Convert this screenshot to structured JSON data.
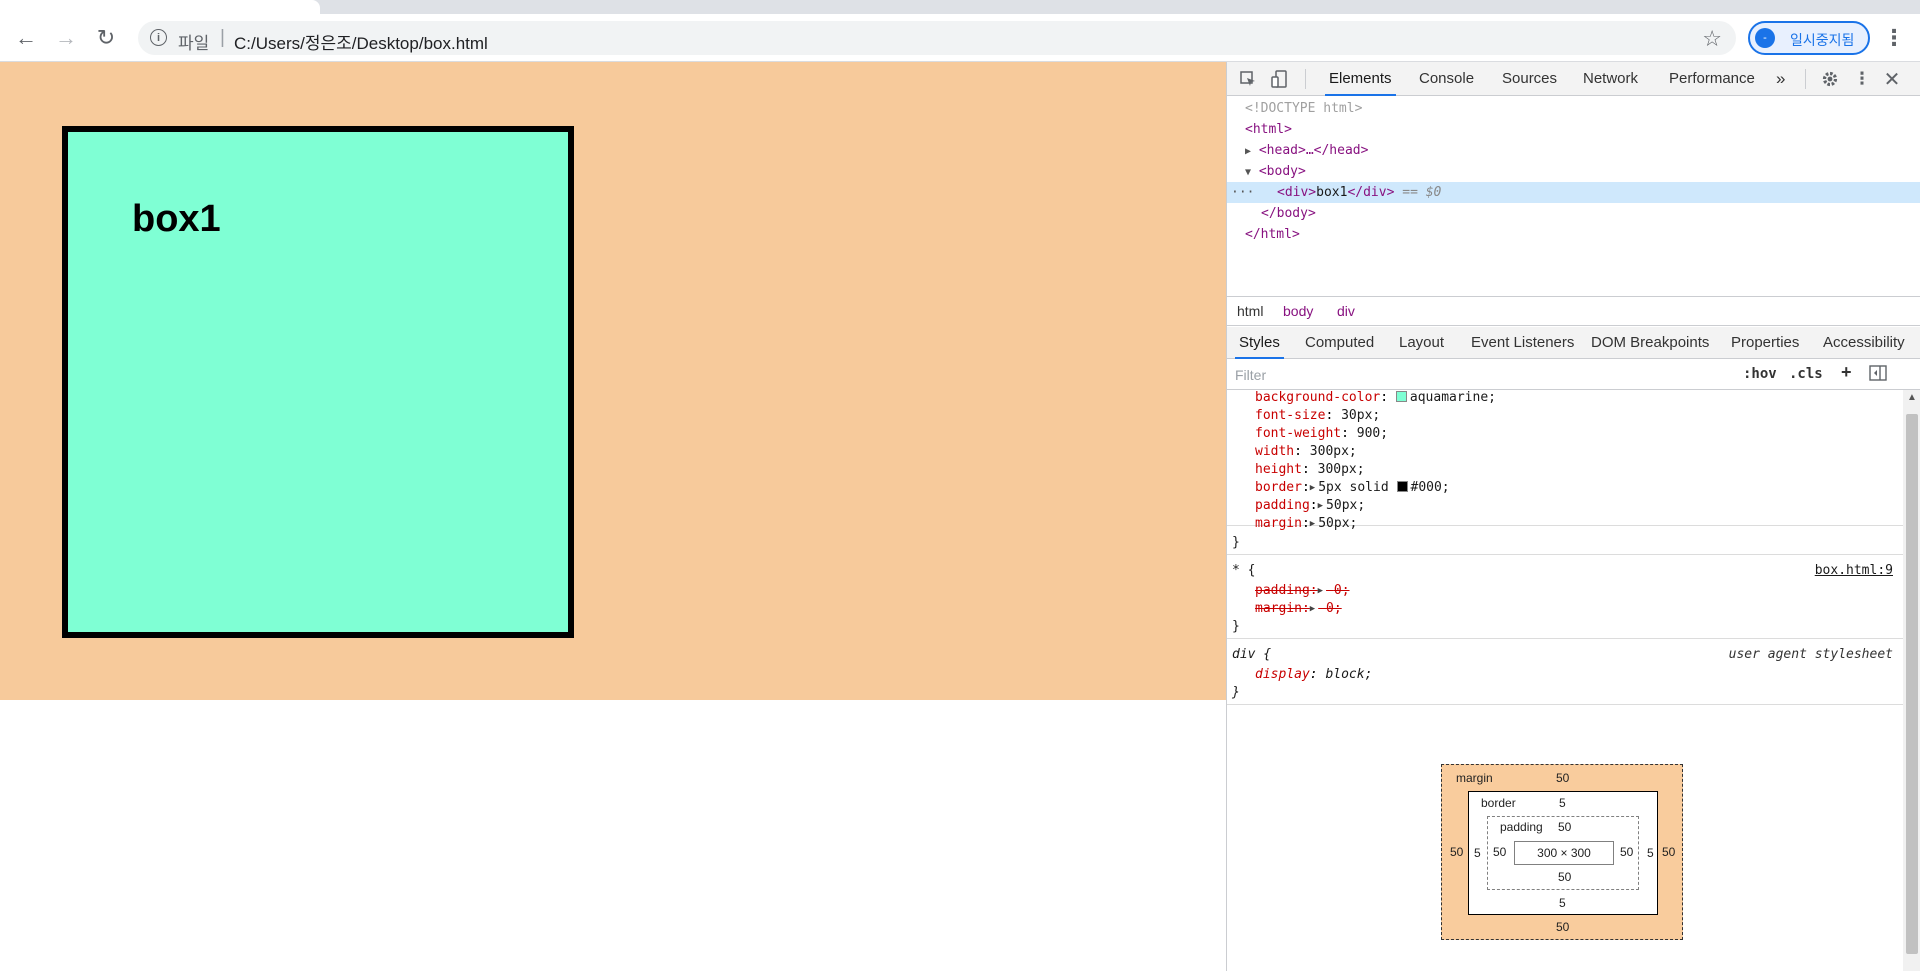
{
  "browser": {
    "nav": {
      "back_icon": "←",
      "forward_icon": "→",
      "reload_icon": "↻"
    },
    "address": {
      "scheme_label": "파일",
      "separator": "|",
      "url": "C:/Users/정은조/Desktop/box.html",
      "info_icon": "i",
      "bookmark_icon": "☆"
    },
    "profile": {
      "avatar_text": "-",
      "label": "일시중지됨"
    },
    "menu_icon": "⋮"
  },
  "page": {
    "box_text": "box1",
    "body_color": "#f7ca9b",
    "box_color": "#7fffd4"
  },
  "devtools": {
    "tabs": [
      "Elements",
      "Console",
      "Sources",
      "Network",
      "Performance"
    ],
    "more_tabs": "»",
    "active_tab": "Elements",
    "dom": {
      "doctype": "<!DOCTYPE html>",
      "html_open": "<html>",
      "head": "<head>…</head>",
      "body_open": "<body>",
      "div_open": "<div>",
      "div_text": "box1",
      "div_close": "</div>",
      "selected_marker": "== $0",
      "ellipsis": "···",
      "body_close": "</body>",
      "html_close": "</html>"
    },
    "breadcrumbs": [
      "html",
      "body",
      "div"
    ],
    "styles_tabs": [
      "Styles",
      "Computed",
      "Layout",
      "Event Listeners",
      "DOM Breakpoints",
      "Properties",
      "Accessibility"
    ],
    "filter": {
      "placeholder": "Filter",
      "hov": ":hov",
      "cls": ".cls",
      "plus": "+"
    },
    "rules": {
      "div_rule": {
        "decls": [
          {
            "prop": "background-color",
            "value": "aquamarine;",
            "swatch": "#7fffd4"
          },
          {
            "prop": "font-size",
            "value": "30px;"
          },
          {
            "prop": "font-weight",
            "value": "900;"
          },
          {
            "prop": "width",
            "value": "300px;"
          },
          {
            "prop": "height",
            "value": "300px;"
          },
          {
            "prop": "border",
            "value": "5px solid",
            "value2": "#000;",
            "swatch": "#000000"
          },
          {
            "prop": "padding",
            "value": "50px;"
          },
          {
            "prop": "margin",
            "value": "50px;"
          }
        ]
      },
      "universal_rule": {
        "selector": "* {",
        "source": "box.html:9",
        "decls": [
          {
            "prop": "padding",
            "value": "0;"
          },
          {
            "prop": "margin",
            "value": "0;"
          }
        ]
      },
      "ua_rule": {
        "selector": "div {",
        "source": "user agent stylesheet",
        "prop": "display",
        "value": "block;"
      },
      "close_brace": "}"
    },
    "box_model": {
      "margin_label": "margin",
      "border_label": "border",
      "padding_label": "padding",
      "margin": "50",
      "border": "5",
      "padding": "50",
      "content": "300 × 300"
    }
  }
}
